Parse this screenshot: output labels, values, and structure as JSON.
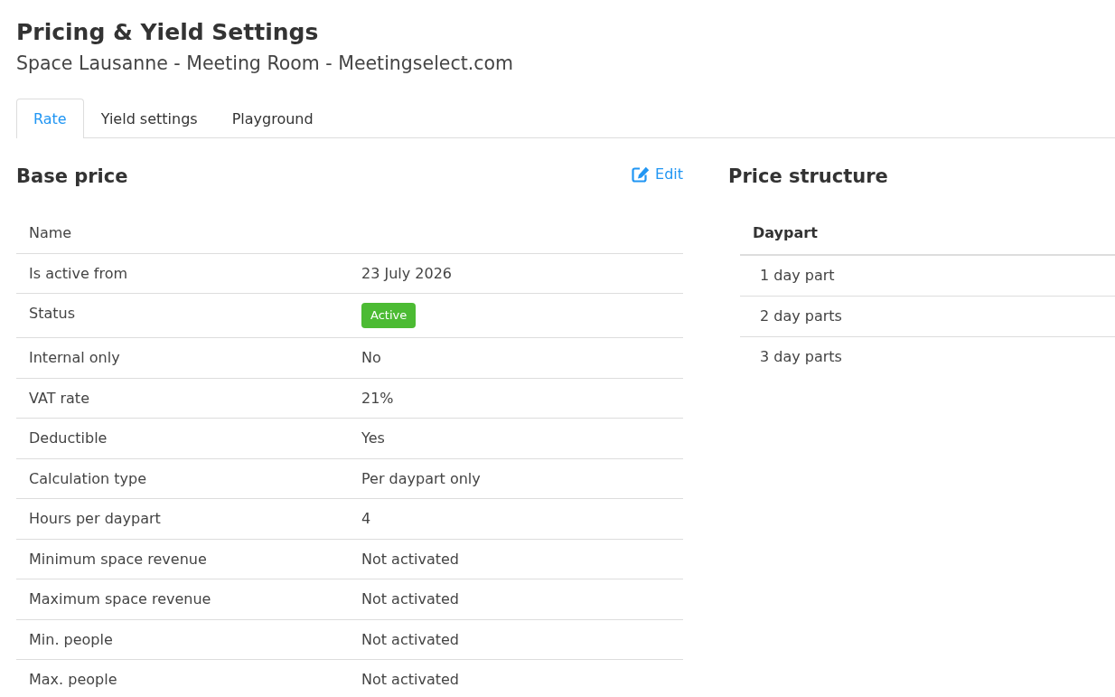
{
  "page": {
    "title": "Pricing & Yield Settings",
    "subtitle": "Space Lausanne - Meeting Room - Meetingselect.com"
  },
  "tabs": [
    {
      "label": "Rate",
      "selected": true
    },
    {
      "label": "Yield settings",
      "selected": false
    },
    {
      "label": "Playground",
      "selected": false
    }
  ],
  "base_price": {
    "title": "Base price",
    "edit_link": "Edit",
    "rows": [
      {
        "kind": "text",
        "label": "Name"
      },
      {
        "kind": "text",
        "label": "Is active from",
        "value": "23 July 2026"
      },
      {
        "kind": "badge",
        "label": "Status",
        "value": "Active"
      },
      {
        "kind": "text",
        "label": "Internal only",
        "value": "No"
      },
      {
        "kind": "text",
        "label": "VAT rate",
        "value": "21%"
      },
      {
        "kind": "text",
        "label": "Deductible",
        "value": "Yes"
      },
      {
        "kind": "text",
        "label": "Calculation type",
        "value": "Per daypart only"
      },
      {
        "kind": "text",
        "label": "Hours per daypart",
        "value": "4"
      },
      {
        "kind": "text",
        "label": "Minimum space revenue",
        "value": "Not activated"
      },
      {
        "kind": "text",
        "label": "Maximum space revenue",
        "value": "Not activated"
      },
      {
        "kind": "text",
        "label": "Min. people",
        "value": "Not activated"
      },
      {
        "kind": "text",
        "label": "Max. people",
        "value": "Not activated"
      }
    ]
  },
  "price_structure": {
    "title": "Price structure",
    "columns": [
      "Daypart"
    ],
    "rows": [
      "1 day part",
      "2 day parts",
      "3 day parts"
    ]
  }
}
